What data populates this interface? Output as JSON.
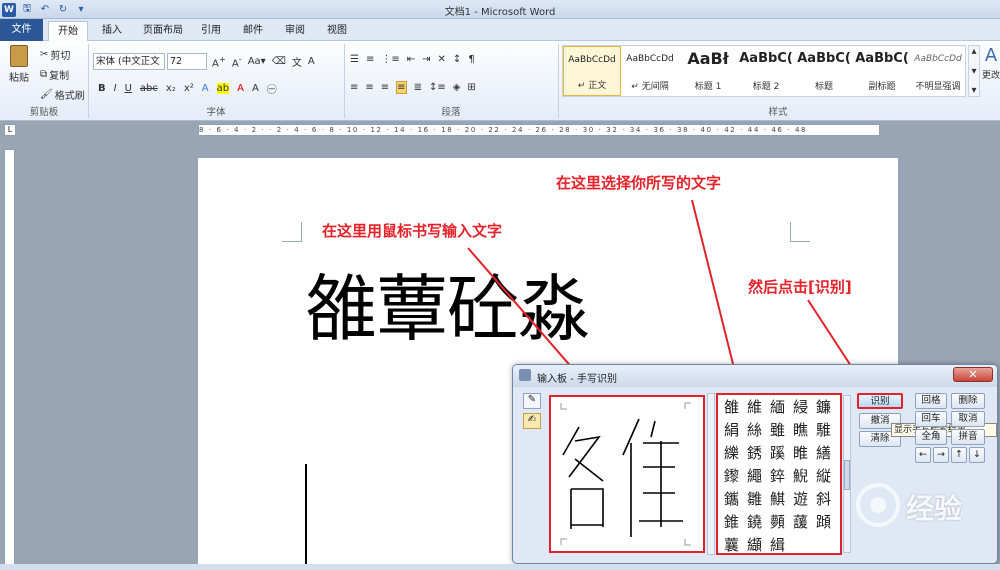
{
  "window": {
    "title": "文档1 - Microsoft Word"
  },
  "tabs": [
    "文件",
    "开始",
    "插入",
    "页面布局",
    "引用",
    "邮件",
    "审阅",
    "视图"
  ],
  "ribbon": {
    "clipboard": {
      "paste": "粘贴",
      "cut": "剪切",
      "copy": "复制",
      "format_painter": "格式刷",
      "label": "剪贴板"
    },
    "font": {
      "name": "宋体 (中文正文",
      "size": "72",
      "label": "字体"
    },
    "paragraph": {
      "label": "段落"
    },
    "styles": {
      "label": "样式",
      "items": [
        {
          "preview": "AaBbCcDd",
          "name": "↵ 正文"
        },
        {
          "preview": "AaBbCcDd",
          "name": "↵ 无间隔"
        },
        {
          "preview": "AaBł",
          "name": "标题 1"
        },
        {
          "preview": "AaBbC(",
          "name": "标题 2"
        },
        {
          "preview": "AaBbC(",
          "name": "标题"
        },
        {
          "preview": "AaBbC(",
          "name": "副标题"
        },
        {
          "preview": "AaBbCcDd",
          "name": "不明显强调"
        }
      ],
      "change": "更改"
    }
  },
  "document": {
    "text": "雒蕈砼淼"
  },
  "annotations": {
    "write_here": "在这里用鼠标书写输入文字",
    "choose_here": "在这里选择你所写的文字",
    "click_recognize": "然后点击[识别]"
  },
  "ime": {
    "title": "输入板 - 手写识别",
    "candidates": [
      "雒",
      "維",
      "緬",
      "綅",
      "鐮",
      "絹",
      "絲",
      "雖",
      "瞧",
      "騅",
      "纅",
      "銹",
      "蹊",
      "睢",
      "繕",
      "鑗",
      "繩",
      "錊",
      "鯢",
      "縦",
      "鑴",
      "雛",
      "鯕",
      "遊",
      "斜",
      "錐",
      "鐃",
      "顭",
      "蘐",
      "蹞",
      "蘘",
      "纈",
      "緝"
    ],
    "buttons": {
      "recognize": "识别",
      "undo": "撤消",
      "clear": "清除",
      "space": "回格",
      "delete": "删除",
      "enter": "回车",
      "cancel": "取消",
      "full": "全角",
      "kana": "拼音"
    },
    "tooltip": "显示手写检索结果"
  },
  "ruler": "8 · 6 · 4 · 2 · · 2 · 4 · 6 · 8 · 10 · 12 · 14 · 16 · 18 · 20 · 22 · 24 · 26 · 28 · 30 · 32 · 34 · 36 · 38 · 40 · 42 · 44 · 46 · 48",
  "watermark": "经验",
  "colors": {
    "accent": "#2b5797",
    "annotation": "#e5222a"
  }
}
